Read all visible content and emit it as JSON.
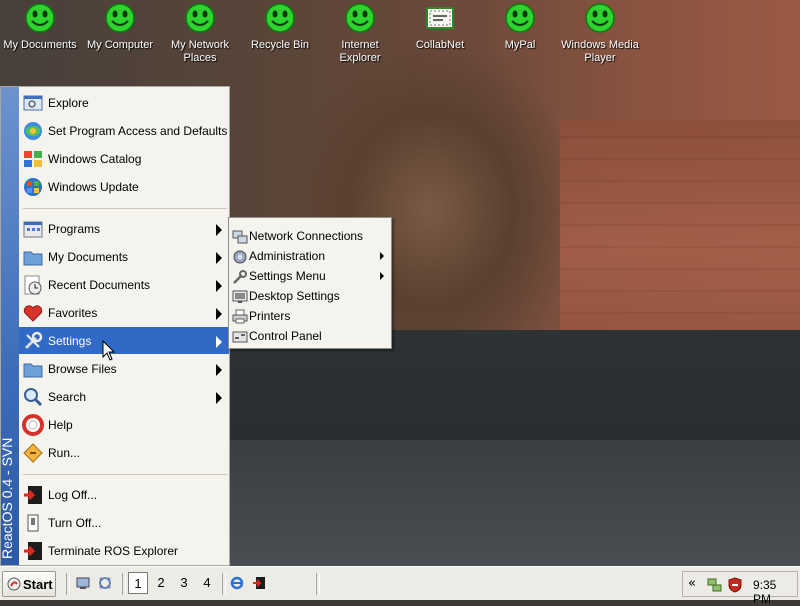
{
  "desktop": {
    "icons": [
      {
        "label": "My Documents",
        "icon": "smiley-icon"
      },
      {
        "label": "My Computer",
        "icon": "smiley-icon"
      },
      {
        "label": "My Network Places",
        "icon": "smiley-icon"
      },
      {
        "label": "Recycle Bin",
        "icon": "smiley-icon"
      },
      {
        "label": "Internet Explorer",
        "icon": "smiley-icon"
      },
      {
        "label": "CollabNet",
        "icon": "envelope-icon"
      },
      {
        "label": "MyPal",
        "icon": "smiley-icon"
      },
      {
        "label": "Windows Media Player",
        "icon": "smiley-icon"
      }
    ]
  },
  "start_menu": {
    "side_label": "ReactOS  0.4 - SVN",
    "top_items": [
      {
        "label": "Explore",
        "icon": "explorer-icon"
      },
      {
        "label": "Set Program Access and Defaults",
        "icon": "program-access-icon"
      },
      {
        "label": "Windows Catalog",
        "icon": "windows-catalog-icon"
      },
      {
        "label": "Windows Update",
        "icon": "windows-update-icon"
      }
    ],
    "main_items": [
      {
        "label": "Programs",
        "icon": "programs-icon",
        "submenu": true
      },
      {
        "label": "My Documents",
        "icon": "folder-icon",
        "submenu": true
      },
      {
        "label": "Recent Documents",
        "icon": "recent-documents-icon",
        "submenu": true
      },
      {
        "label": "Favorites",
        "icon": "heart-icon",
        "submenu": true
      },
      {
        "label": "Settings",
        "icon": "settings-icon",
        "submenu": true,
        "active": true
      },
      {
        "label": "Browse Files",
        "icon": "folder-icon",
        "submenu": true
      },
      {
        "label": "Search",
        "icon": "search-icon",
        "submenu": true
      },
      {
        "label": "Help",
        "icon": "help-icon",
        "submenu": false
      },
      {
        "label": "Run...",
        "icon": "run-icon",
        "submenu": false
      }
    ],
    "bottom_items": [
      {
        "label": "Log Off...",
        "icon": "log-off-icon"
      },
      {
        "label": "Turn Off...",
        "icon": "turn-off-icon"
      },
      {
        "label": "Terminate ROS Explorer",
        "icon": "terminate-icon"
      }
    ]
  },
  "settings_submenu": {
    "items": [
      {
        "label": "Network Connections",
        "icon": "network-icon",
        "submenu": false
      },
      {
        "label": "Administration",
        "icon": "administration-icon",
        "submenu": true
      },
      {
        "label": "Settings Menu",
        "icon": "settings-menu-icon",
        "submenu": true
      },
      {
        "label": "Desktop Settings",
        "icon": "desktop-settings-icon",
        "submenu": false
      },
      {
        "label": "Printers",
        "icon": "printer-icon",
        "submenu": false
      },
      {
        "label": "Control Panel",
        "icon": "control-panel-icon",
        "submenu": false
      }
    ]
  },
  "taskbar": {
    "start_label": "Start",
    "workspaces": [
      "1",
      "2",
      "3",
      "4"
    ],
    "active_workspace": "1",
    "clock": "9:35 PM"
  },
  "colors": {
    "menu_highlight": "#3169c6",
    "menu_background": "#f4f3ee",
    "sidebar_blue": "#3d6cb8",
    "taskbar": "#ecebe5"
  }
}
